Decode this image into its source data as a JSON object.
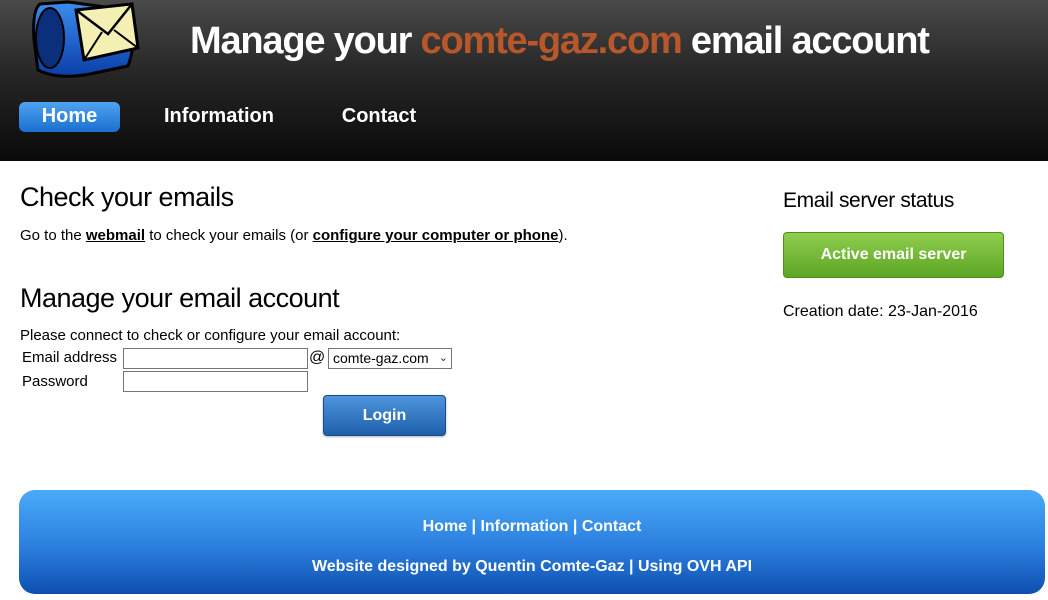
{
  "header": {
    "title_prefix": "Manage your ",
    "title_domain": "comte-gaz.com",
    "title_suffix": " email account",
    "logo_icon": "mailbox-envelope-icon"
  },
  "nav": {
    "items": [
      {
        "label": "Home",
        "active": true
      },
      {
        "label": "Information",
        "active": false
      },
      {
        "label": "Contact",
        "active": false
      }
    ]
  },
  "check_emails": {
    "title": "Check your emails",
    "text_before": "Go to the ",
    "webmail_link": "webmail",
    "text_middle": " to check your emails (or ",
    "configure_link": "configure your computer or phone",
    "text_after": ")."
  },
  "manage": {
    "title": "Manage your email account",
    "instruction": "Please connect to check or configure your email account:",
    "email_label": "Email address",
    "email_value": "",
    "at_sign": "@",
    "domain_selected": "comte-gaz.com",
    "password_label": "Password",
    "password_value": "",
    "login_button": "Login"
  },
  "status": {
    "title": "Email server status",
    "server_button": "Active email server",
    "creation_date": "Creation date: 23-Jan-2016"
  },
  "footer": {
    "links": [
      "Home",
      "Information",
      "Contact"
    ],
    "separator": " | ",
    "credit_author": "Website designed by Quentin Comte-Gaz",
    "credit_api": "Using OVH API"
  },
  "colors": {
    "domain_accent": "#b8572a",
    "nav_active": "#2e86e0",
    "status_green": "#74bb38",
    "login_blue": "#2f74c4",
    "footer_blue": "#2b7fde"
  }
}
